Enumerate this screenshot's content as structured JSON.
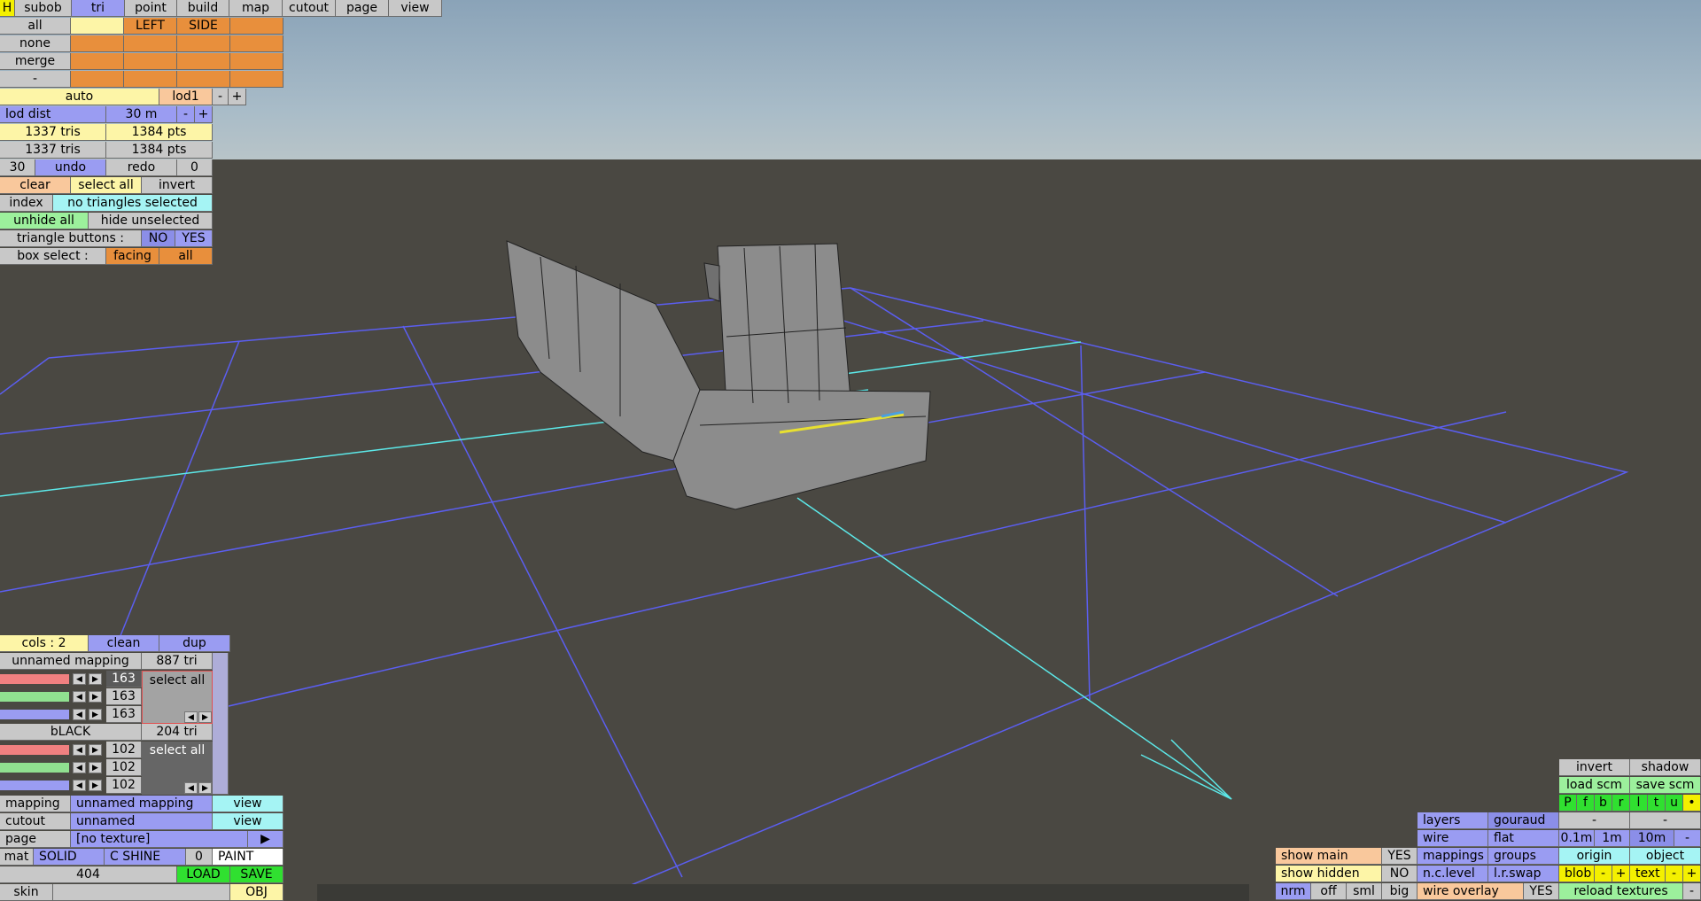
{
  "menu": {
    "h": "H",
    "tabs": [
      "subob",
      "tri",
      "point",
      "build",
      "map",
      "cutout",
      "page",
      "view"
    ]
  },
  "side_grid": {
    "all": "all",
    "none": "none",
    "merge": "merge",
    "dash": "-",
    "left": "LEFT",
    "side": "SIDE"
  },
  "lod": {
    "auto": "auto",
    "lod1": "lod1",
    "minus": "-",
    "plus": "+",
    "dist_label": "lod dist",
    "dist_value": "30 m"
  },
  "stats": {
    "tris1": "1337 tris",
    "pts1": "1384 pts",
    "tris2": "1337 tris",
    "pts2": "1384 pts"
  },
  "history": {
    "count": "30",
    "undo": "undo",
    "redo": "redo",
    "redo_count": "0"
  },
  "select": {
    "clear": "clear",
    "select_all": "select all",
    "invert": "invert",
    "index": "index",
    "status": "no triangles selected",
    "unhide_all": "unhide all",
    "hide_unselected": "hide unselected",
    "tri_buttons": "triangle buttons :",
    "no": "NO",
    "yes": "YES",
    "box_select": "box select :",
    "facing": "facing",
    "all": "all"
  },
  "mappings": {
    "cols": "cols : 2",
    "clean": "clean",
    "dup": "dup",
    "m1": {
      "name": "unnamed mapping",
      "count": "887 tri",
      "r": "163",
      "g": "163",
      "b": "163",
      "select_all": "select all"
    },
    "m2": {
      "name": "bLACK",
      "count": "204 tri",
      "r": "102",
      "g": "102",
      "b": "102",
      "select_all": "select all"
    }
  },
  "props": {
    "mapping_label": "mapping",
    "mapping_value": "unnamed mapping",
    "view1": "view",
    "cutout_label": "cutout",
    "cutout_value": "unnamed",
    "view2": "view",
    "page_label": "page",
    "page_value": "[no texture]",
    "page_arrow": "▶",
    "mat": "mat",
    "solid": "SOLID",
    "cshine": "C SHINE",
    "zero": "0",
    "paint": "PAINT",
    "num": "404",
    "load": "LOAD",
    "save": "SAVE",
    "skin": "skin",
    "obj": "OBJ"
  },
  "right": {
    "invert": "invert",
    "shadow": "shadow",
    "load_scm": "load scm",
    "save_scm": "save scm",
    "letters": [
      "P",
      "f",
      "b",
      "r",
      "l",
      "t",
      "u",
      "•"
    ],
    "layers": "layers",
    "gouraud": "gouraud",
    "dash1": "-",
    "dash2": "-",
    "wire": "wire",
    "flat": "flat",
    "d01": "0.1m",
    "d1": "1m",
    "d10": "10m",
    "dminus": "-",
    "show_main": "show main",
    "yes1": "YES",
    "mappings": "mappings",
    "groups": "groups",
    "origin": "origin",
    "object": "object",
    "show_hidden": "show hidden",
    "no1": "NO",
    "nclevel": "n.c.level",
    "lrswap": "l.r.swap",
    "blob": "blob",
    "bm": "-",
    "bp": "+",
    "text": "text",
    "tm": "-",
    "tp": "+",
    "nrm": "nrm",
    "off": "off",
    "sml": "sml",
    "big": "big",
    "wire_overlay": "wire overlay",
    "yes2": "YES",
    "reload": "reload textures",
    "rminus": "-"
  },
  "colors": {
    "grid": "#5b5ef0",
    "axis": "#5ce8e8",
    "model": "#8c8c8c",
    "wire": "#222222"
  }
}
